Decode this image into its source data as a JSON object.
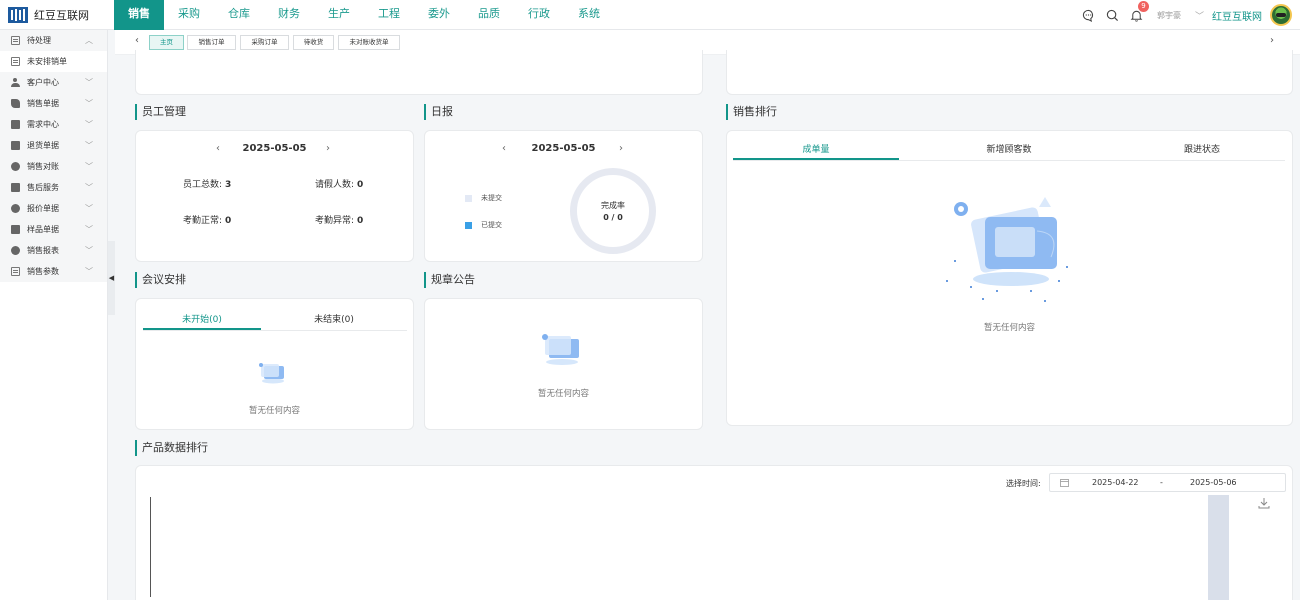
{
  "app": {
    "name": "红豆互联网"
  },
  "nav": [
    "销售",
    "采购",
    "仓库",
    "财务",
    "生产",
    "工程",
    "委外",
    "品质",
    "行政",
    "系统"
  ],
  "header": {
    "badge_count": "9",
    "user": "郭宇豪",
    "company": "红豆互联网"
  },
  "sidebar": {
    "items": [
      {
        "label": "待处理",
        "icon": "document-icon",
        "chevron": "︿"
      },
      {
        "label": "未安排销单",
        "icon": "document-icon",
        "chevron": ""
      },
      {
        "label": "客户中心",
        "icon": "user-icon",
        "chevron": "﹀"
      },
      {
        "label": "销售单据",
        "icon": "tag-icon",
        "chevron": "﹀"
      },
      {
        "label": "需求中心",
        "icon": "box-icon",
        "chevron": "﹀"
      },
      {
        "label": "退货单据",
        "icon": "box-icon",
        "chevron": "﹀"
      },
      {
        "label": "销售对账",
        "icon": "coin-icon",
        "chevron": "﹀"
      },
      {
        "label": "售后服务",
        "icon": "box-icon",
        "chevron": "﹀"
      },
      {
        "label": "报价单据",
        "icon": "coin-icon",
        "chevron": "﹀"
      },
      {
        "label": "样品单据",
        "icon": "box-icon",
        "chevron": "﹀"
      },
      {
        "label": "销售报表",
        "icon": "coin-icon",
        "chevron": "﹀"
      },
      {
        "label": "销售参数",
        "icon": "document-icon",
        "chevron": "﹀"
      }
    ]
  },
  "tabs": [
    "主页",
    "销售订单",
    "采购订单",
    "待收货",
    "未对账收货单"
  ],
  "employee": {
    "title": "员工管理",
    "date": "2025-05-05",
    "total_label": "员工总数:",
    "total": "3",
    "leave_label": "请假人数:",
    "leave": "0",
    "normal_label": "考勤正常:",
    "normal": "0",
    "abnormal_label": "考勤异常:",
    "abnormal": "0"
  },
  "daily": {
    "title": "日报",
    "date": "2025-05-05",
    "legend_unsubmitted": "未提交",
    "legend_submitted": "已提交",
    "ring_label": "完成率",
    "ring_value": "0 / 0",
    "colors": {
      "unsubmitted": "#e3e9f5",
      "submitted": "#3aa0e6"
    }
  },
  "ranking": {
    "title": "销售排行",
    "tabs": [
      "成单量",
      "新增顾客数",
      "跟进状态"
    ],
    "empty": "暂无任何内容"
  },
  "meeting": {
    "title": "会议安排",
    "tabs": [
      "未开始(0)",
      "未结束(0)"
    ],
    "empty": "暂无任何内容"
  },
  "notice": {
    "title": "规章公告",
    "empty": "暂无任何内容"
  },
  "product": {
    "title": "产品数据排行",
    "range_label": "选择时间:",
    "start": "2025-04-22",
    "sep": "-",
    "end": "2025-05-06"
  }
}
